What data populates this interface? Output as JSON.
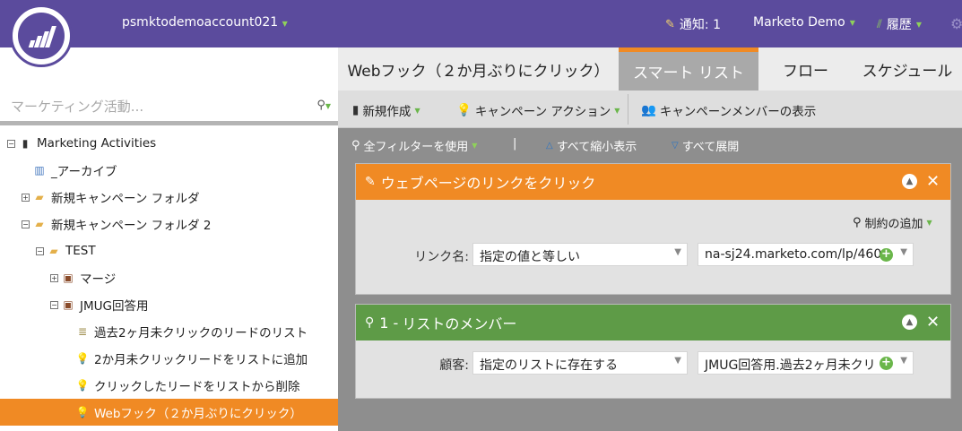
{
  "header": {
    "account": "psmktodemoaccount021",
    "notifications": "通知: 1",
    "user": "Marketo Demo",
    "history": "履歴"
  },
  "sidebar": {
    "search_placeholder": "マーケティング活動...",
    "tree": [
      {
        "label": "Marketing Activities",
        "toggle": "⊟",
        "icon": "book"
      },
      {
        "label": "_アーカイブ",
        "toggle": "",
        "icon": "archive"
      },
      {
        "label": "新規キャンペーン フォルダ",
        "toggle": "⊞",
        "icon": "folder"
      },
      {
        "label": "新規キャンペーン フォルダ 2",
        "toggle": "⊟",
        "icon": "folder"
      },
      {
        "label": "TEST",
        "toggle": "⊟",
        "icon": "folder"
      },
      {
        "label": "マージ",
        "toggle": "⊞",
        "icon": "program"
      },
      {
        "label": "JMUG回答用",
        "toggle": "⊟",
        "icon": "program"
      },
      {
        "label": "過去2ヶ月未クリックのリードのリスト",
        "toggle": "",
        "icon": "list"
      },
      {
        "label": "2か月未クリックリードをリストに追加",
        "toggle": "",
        "icon": "bulb"
      },
      {
        "label": "クリックしたリードをリストから削除",
        "toggle": "",
        "icon": "bulb"
      },
      {
        "label": "Webフック（２か月ぶりにクリック）",
        "toggle": "",
        "icon": "bulb",
        "selected": true
      }
    ]
  },
  "tabs": [
    {
      "label": "Webフック（２か月ぶりにクリック）",
      "active": false
    },
    {
      "label": "スマート リスト",
      "active": true
    },
    {
      "label": "フロー",
      "active": false
    },
    {
      "label": "スケジュール",
      "active": false
    }
  ],
  "toolbar": {
    "new": "新規作成",
    "campaign_actions": "キャンペーン アクション",
    "view_members": "キャンペーンメンバーの表示"
  },
  "subbar": {
    "use_all_filters": "全フィルターを使用",
    "separator": "|",
    "collapse_all": "すべて縮小表示",
    "expand_all": "すべて展開"
  },
  "filters": [
    {
      "title": "ウェブページのリンクをクリック",
      "color": "#f08a24",
      "constraint": "制約の追加",
      "label": "リンク名:",
      "operator": "指定の値と等しい",
      "value": "na-sj24.marketo.com/lp/460-"
    },
    {
      "number": "1 -",
      "title": "リストのメンバー",
      "color": "#5e9b47",
      "label": "顧客:",
      "operator": "指定のリストに存在する",
      "value": "JMUG回答用.過去2ヶ月未クリ"
    }
  ]
}
